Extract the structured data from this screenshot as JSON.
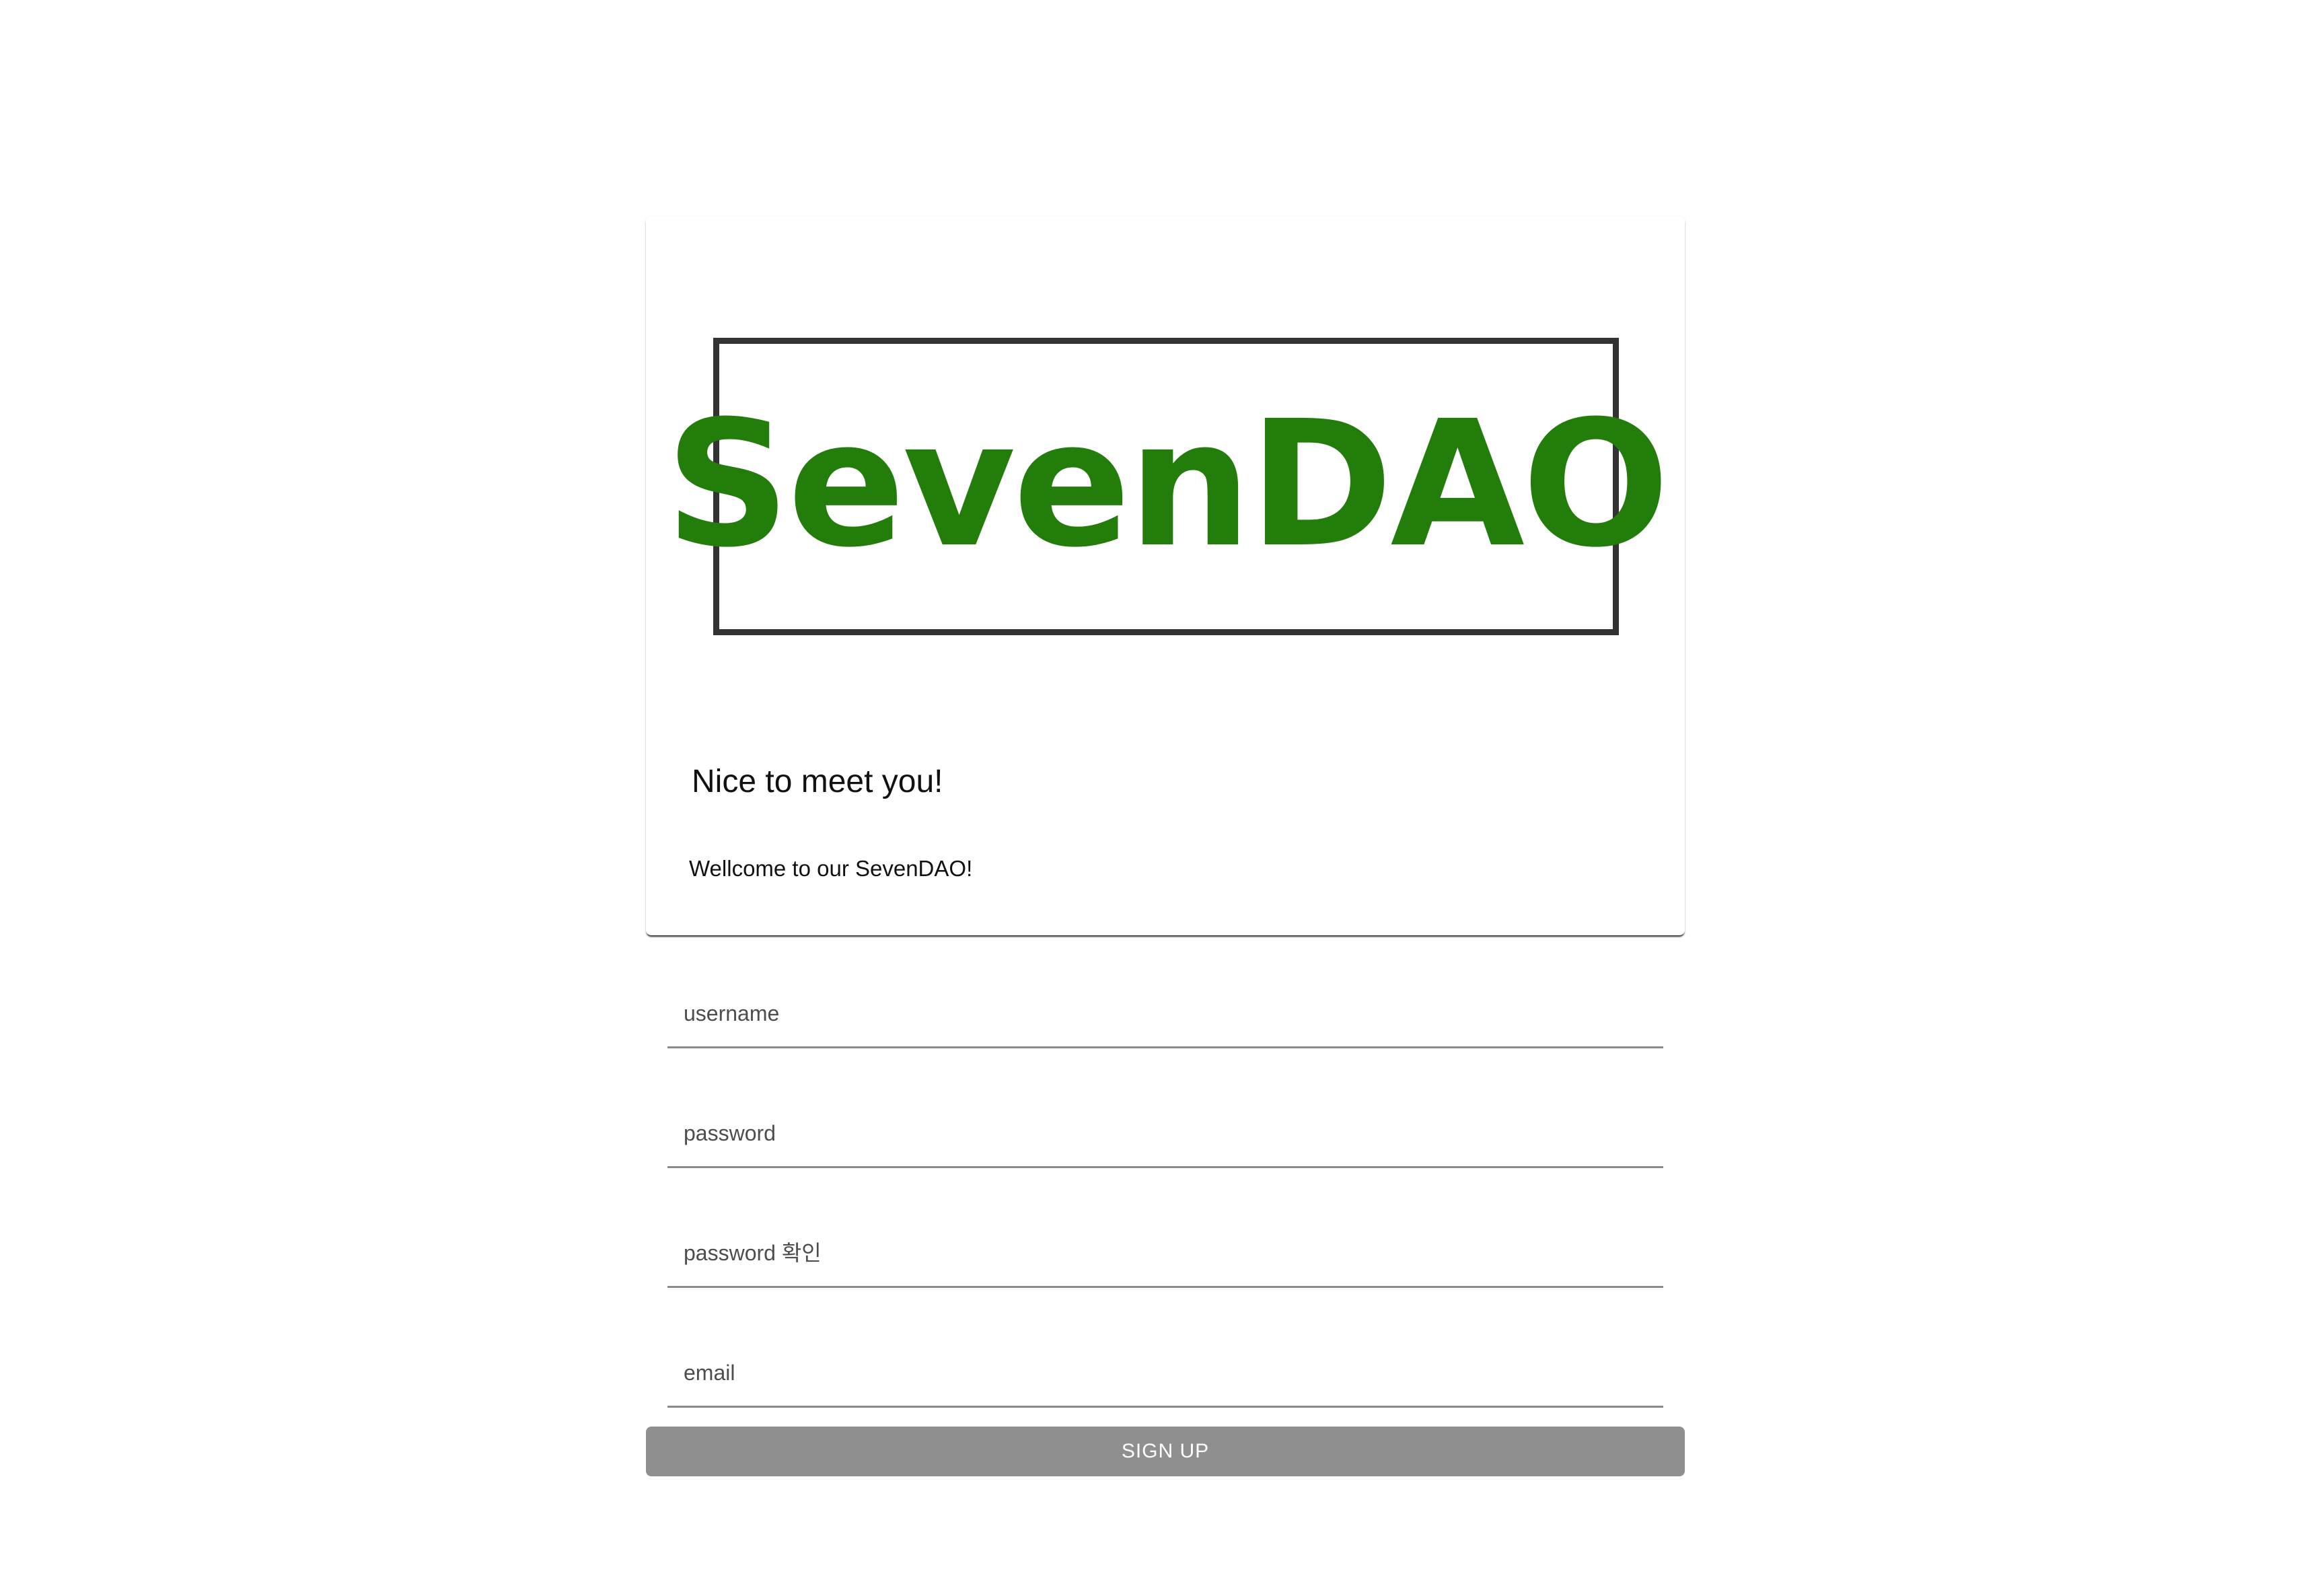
{
  "card": {
    "logo_text": "SevenDAO",
    "title": "Nice to meet you!",
    "subtitle": "Wellcome to our SevenDAO!"
  },
  "form": {
    "username_placeholder": "username",
    "password_placeholder": "password",
    "password_confirm_placeholder": "password 확인",
    "email_placeholder": "email",
    "submit_label": "SIGN UP"
  },
  "colors": {
    "logo_green": "#237d0a",
    "logo_border": "#333333",
    "button_disabled": "#8f8f8f"
  }
}
